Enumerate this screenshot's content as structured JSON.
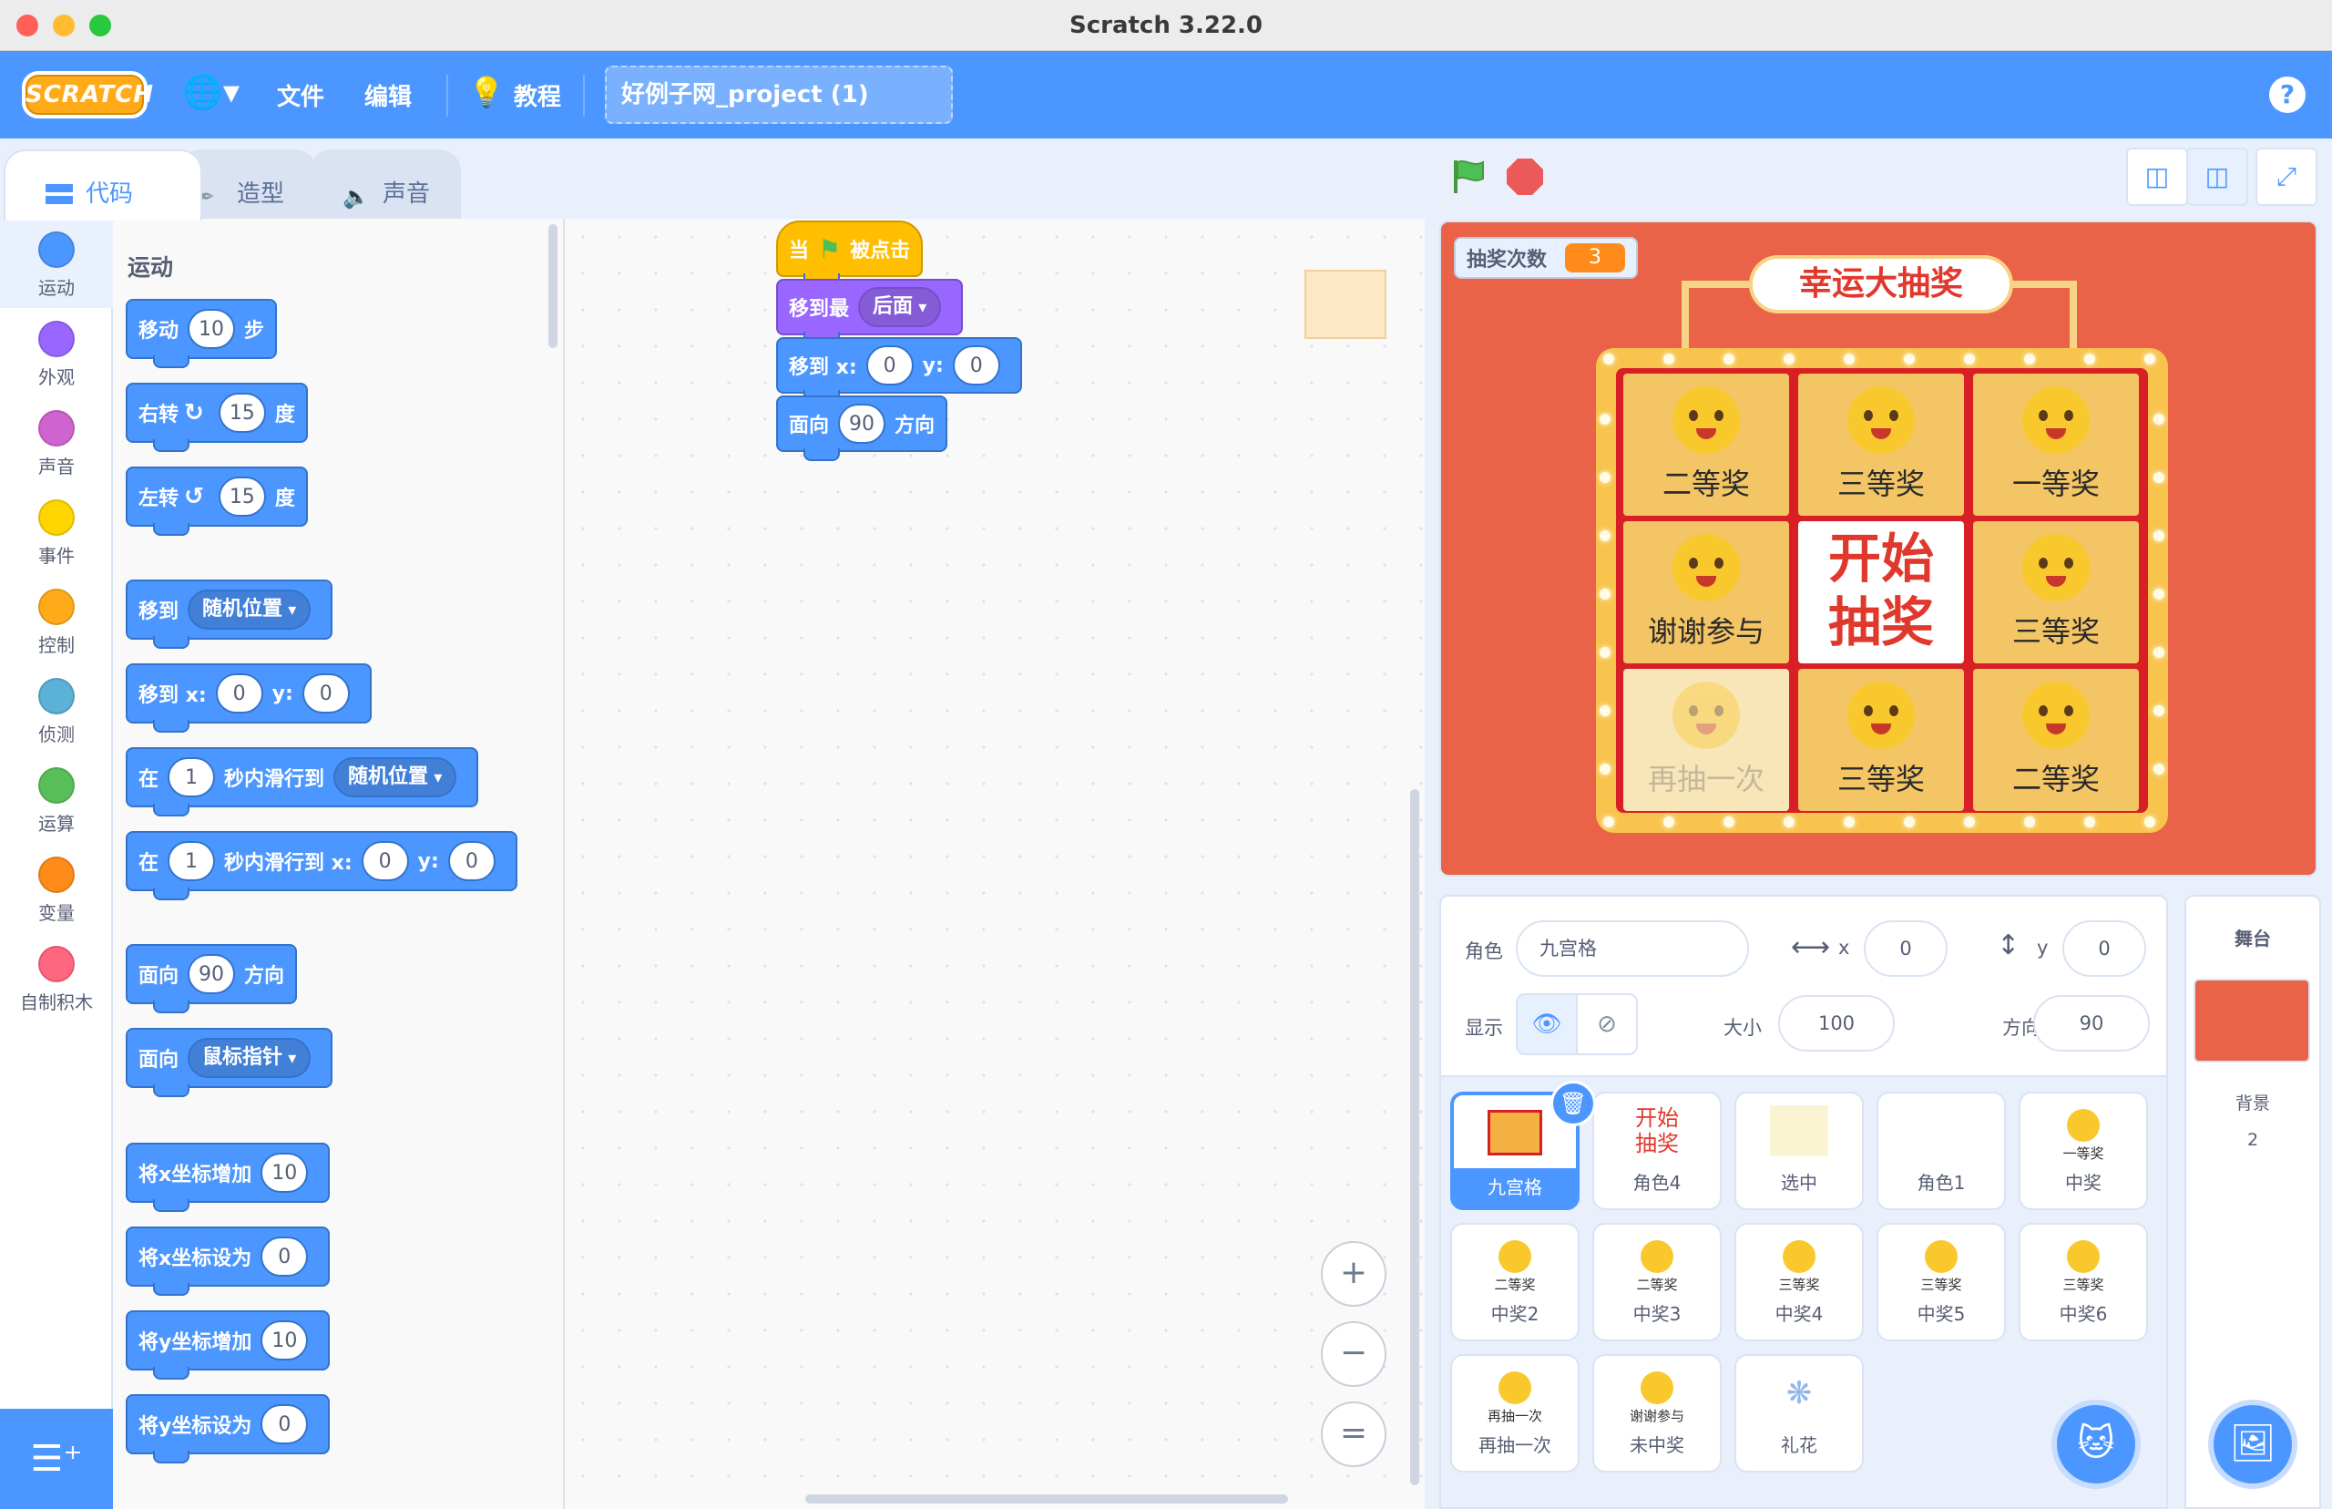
{
  "window": {
    "title": "Scratch 3.22.0"
  },
  "menu": {
    "logo": "SCRATCH",
    "file": "文件",
    "edit": "编辑",
    "tutorials": "教程",
    "project_title": "好例子网_project (1)",
    "help": "?"
  },
  "tabs": [
    {
      "label": "代码"
    },
    {
      "label": "造型"
    },
    {
      "label": "声音"
    }
  ],
  "categories": [
    {
      "label": "运动",
      "color": "#4c97ff"
    },
    {
      "label": "外观",
      "color": "#9966ff"
    },
    {
      "label": "声音",
      "color": "#cf63cf"
    },
    {
      "label": "事件",
      "color": "#ffd500"
    },
    {
      "label": "控制",
      "color": "#ffab19"
    },
    {
      "label": "侦测",
      "color": "#5cb1d6"
    },
    {
      "label": "运算",
      "color": "#59c059"
    },
    {
      "label": "变量",
      "color": "#ff8c1a"
    },
    {
      "label": "自制积木",
      "color": "#ff6680"
    }
  ],
  "palette": {
    "heading": "运动",
    "move": {
      "a": "移动",
      "n": "10",
      "b": "步"
    },
    "turn_right": {
      "a": "右转",
      "n": "15",
      "b": "度"
    },
    "turn_left": {
      "a": "左转",
      "n": "15",
      "b": "度"
    },
    "goto": {
      "a": "移到",
      "dd": "随机位置"
    },
    "goto_xy": {
      "a": "移到 x:",
      "x": "0",
      "b": "y:",
      "y": "0"
    },
    "glide": {
      "a": "在",
      "n": "1",
      "b": "秒内滑行到",
      "dd": "随机位置"
    },
    "glide_xy": {
      "a": "在",
      "n": "1",
      "b": "秒内滑行到 x:",
      "x": "0",
      "c": "y:",
      "y": "0"
    },
    "point_dir": {
      "a": "面向",
      "n": "90",
      "b": "方向"
    },
    "point_towards": {
      "a": "面向",
      "dd": "鼠标指针"
    },
    "change_x": {
      "a": "将x坐标增加",
      "n": "10"
    },
    "set_x": {
      "a": "将x坐标设为",
      "n": "0"
    },
    "change_y": {
      "a": "将y坐标增加",
      "n": "10"
    },
    "set_y": {
      "a": "将y坐标设为",
      "n": "0"
    }
  },
  "script": {
    "hat": {
      "a": "当",
      "b": "被点击"
    },
    "layer": {
      "a": "移到最",
      "dd": "后面"
    },
    "goto_xy": {
      "a": "移到 x:",
      "x": "0",
      "b": "y:",
      "y": "0"
    },
    "dir": {
      "a": "面向",
      "n": "90",
      "b": "方向"
    }
  },
  "zoom": {
    "in": "+",
    "out": "−",
    "reset": "="
  },
  "stage": {
    "monitor_label": "抽奖次数",
    "monitor_value": "3",
    "banner": "幸运大抽奖",
    "grid": [
      "二等奖",
      "三等奖",
      "一等奖",
      "谢谢参与",
      "开始\n抽奖",
      "三等奖",
      "再抽一次",
      "三等奖",
      "二等奖"
    ],
    "bg_color": "#ea6247"
  },
  "sprite_info": {
    "sprite_label": "角色",
    "sprite_name": "九宫格",
    "x_label": "x",
    "x": "0",
    "y_label": "y",
    "y": "0",
    "show_label": "显示",
    "size_label": "大小",
    "size": "100",
    "direction_label": "方向",
    "direction": "90"
  },
  "sprites": [
    {
      "name": "九宫格",
      "thumb": ""
    },
    {
      "name": "角色4",
      "thumb": "开始\n抽奖"
    },
    {
      "name": "选中",
      "thumb": ""
    },
    {
      "name": "角色1",
      "thumb": ""
    },
    {
      "name": "中奖",
      "thumb": "一等奖"
    },
    {
      "name": "中奖2",
      "thumb": "二等奖"
    },
    {
      "name": "中奖3",
      "thumb": "二等奖"
    },
    {
      "name": "中奖4",
      "thumb": "三等奖"
    },
    {
      "name": "中奖5",
      "thumb": "三等奖"
    },
    {
      "name": "中奖6",
      "thumb": "三等奖"
    },
    {
      "name": "再抽一次",
      "thumb": "再抽一次"
    },
    {
      "name": "未中奖",
      "thumb": "谢谢参与"
    },
    {
      "name": "礼花",
      "thumb": ""
    }
  ],
  "stage_panel": {
    "title": "舞台",
    "backdrops_label": "背景",
    "backdrops_count": "2"
  }
}
